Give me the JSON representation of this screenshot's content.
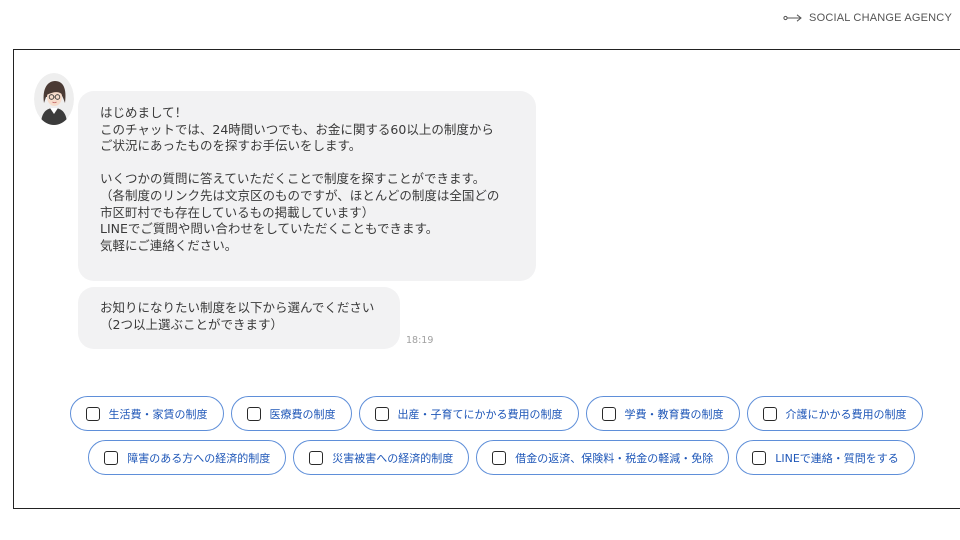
{
  "brand": {
    "name": "SOCIAL CHANGE AGENCY",
    "icon": "arrow-right-icon"
  },
  "chat": {
    "avatar_icon": "woman-avatar-icon",
    "messages": [
      {
        "lines": [
          "はじめまして！",
          "このチャットでは、24時間いつでも、お金に関する60以上の制度から",
          "ご状況にあったものを探すお手伝いをします。",
          "",
          "いくつかの質問に答えていただくことで制度を探すことができます。",
          "（各制度のリンク先は文京区のものですが、ほとんどの制度は全国どの",
          "市区町村でも存在しているもの掲載しています）",
          "LINEでご質問や問い合わせをしていただくこともできます。",
          "気軽にご連絡ください。"
        ]
      },
      {
        "lines": [
          "お知りになりたい制度を以下から選んでください",
          "（2つ以上選ぶことができます）"
        ]
      }
    ],
    "timestamp": "18:19"
  },
  "options": [
    "生活費・家賃の制度",
    "医療費の制度",
    "出産・子育てにかかる費用の制度",
    "学費・教育費の制度",
    "介護にかかる費用の制度",
    "障害のある方への経済的制度",
    "災害被害への経済的制度",
    "借金の返済、保険料・税金の軽減・免除",
    "LINEで連絡・質問をする"
  ],
  "colors": {
    "accent": "#5f8fd9",
    "option_text": "#1f57b8",
    "bubble_bg": "#f2f2f3"
  }
}
